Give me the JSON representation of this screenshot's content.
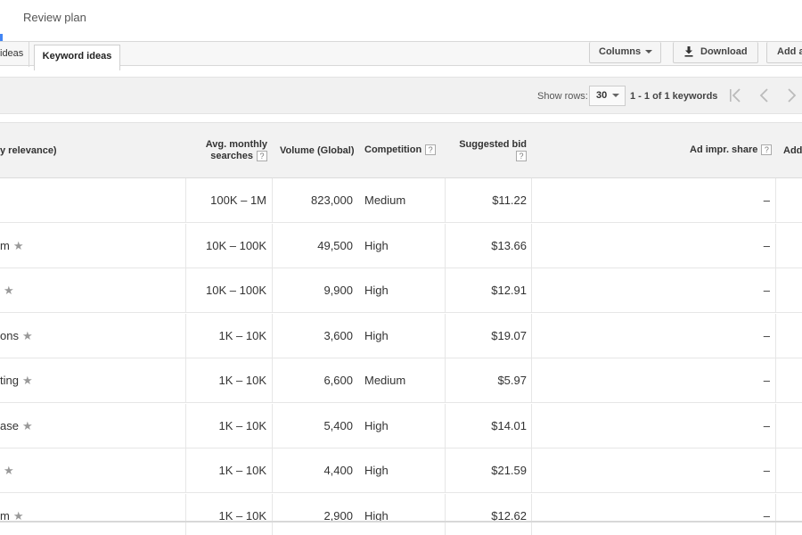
{
  "header": {
    "review_plan": "Review plan"
  },
  "tabs": {
    "prev_label": "ideas",
    "active_label": "Keyword ideas"
  },
  "toolbar": {
    "columns_label": "Columns",
    "download_label": "Download",
    "add_label": "Add a"
  },
  "pager": {
    "show_rows_label": "Show rows:",
    "rows_value": "30",
    "page_info": "1 - 1 of 1 keywords"
  },
  "table": {
    "headers": {
      "keyword": "y relevance)",
      "avg_line1": "Avg. monthly",
      "avg_line2": "searches",
      "volume": "Volume (Global)",
      "competition": "Competition",
      "bid_line1": "Suggested bid",
      "ad_share": "Ad impr. share",
      "add": "Add"
    },
    "help_mark": "?",
    "rows": [
      {
        "keyword": "",
        "star": false,
        "avg": "100K – 1M",
        "volume": "823,000",
        "competition": "Medium",
        "bid": "$11.22",
        "share": "–"
      },
      {
        "keyword": "m",
        "star": true,
        "avg": "10K – 100K",
        "volume": "49,500",
        "competition": "High",
        "bid": "$13.66",
        "share": "–"
      },
      {
        "keyword": "",
        "star": true,
        "avg": "10K – 100K",
        "volume": "9,900",
        "competition": "High",
        "bid": "$12.91",
        "share": "–"
      },
      {
        "keyword": "ons",
        "star": true,
        "avg": "1K – 10K",
        "volume": "3,600",
        "competition": "High",
        "bid": "$19.07",
        "share": "–"
      },
      {
        "keyword": "ting",
        "star": true,
        "avg": "1K – 10K",
        "volume": "6,600",
        "competition": "Medium",
        "bid": "$5.97",
        "share": "–"
      },
      {
        "keyword": "ase",
        "star": true,
        "avg": "1K – 10K",
        "volume": "5,400",
        "competition": "High",
        "bid": "$14.01",
        "share": "–"
      },
      {
        "keyword": "",
        "star": true,
        "avg": "1K – 10K",
        "volume": "4,400",
        "competition": "High",
        "bid": "$21.59",
        "share": "–"
      },
      {
        "keyword": "m",
        "star": true,
        "avg": "1K – 10K",
        "volume": "2,900",
        "competition": "High",
        "bid": "$12.62",
        "share": "–"
      }
    ]
  },
  "icons": {
    "download": "download-icon",
    "star": "star-icon",
    "first": "first-page-icon",
    "prev": "prev-page-icon",
    "next": "next-page-icon"
  },
  "colors": {
    "accent": "#4285f4"
  }
}
